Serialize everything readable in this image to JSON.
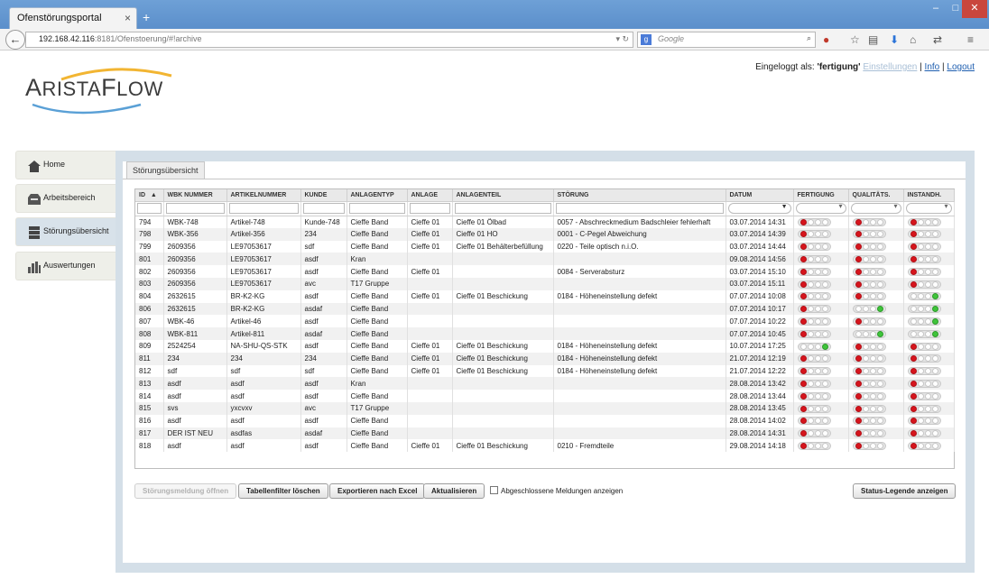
{
  "browser": {
    "tab_title": "Ofenstörungsportal",
    "url_host": "192.168.42.116",
    "url_rest": ":8181/Ofenstoerung/#!archive",
    "search_placeholder": "Google",
    "win_min": "–",
    "win_max": "□",
    "win_close": "✕"
  },
  "header": {
    "logo_first": "A",
    "logo_mid": "RISTA",
    "logo_f": "F",
    "logo_end": "LOW",
    "logged_in_label": "Eingeloggt als:",
    "user": "'fertigung'",
    "settings": "Einstellungen",
    "info": "Info",
    "logout": "Logout",
    "sep": "|"
  },
  "sidebar": {
    "items": [
      {
        "label": "Home",
        "icon": "home-icon"
      },
      {
        "label": "Arbeitsbereich",
        "icon": "inbox-icon"
      },
      {
        "label": "Störungsübersicht",
        "icon": "server-icon"
      },
      {
        "label": "Auswertungen",
        "icon": "bar-chart-icon"
      }
    ],
    "active_index": 2
  },
  "main": {
    "tab_label": "Störungsübersicht"
  },
  "table": {
    "sort_indicator": "▲",
    "columns": [
      "ID",
      "WBK NUMMER",
      "ARTIKELNUMMER",
      "KUNDE",
      "ANLAGENTYP",
      "ANLAGE",
      "ANLAGENTEIL",
      "STÖRUNG",
      "DATUM",
      "FERTIGUNG",
      "QUALITÄTS.",
      "INSTANDH."
    ],
    "rows": [
      {
        "id": "794",
        "wbk": "WBK-748",
        "artikel": "Artikel-748",
        "kunde": "Kunde-748",
        "typ": "Cieffe Band",
        "anlage": "Cieffe 01",
        "teil": "Cieffe 01 Ölbad",
        "stoerung": "0057 - Abschreckmedium Badschleier fehlerhaft",
        "datum": "03.07.2014 14:31",
        "f": "red",
        "q": "red",
        "i": "red"
      },
      {
        "id": "798",
        "wbk": "WBK-356",
        "artikel": "Artikel-356",
        "kunde": "234",
        "typ": "Cieffe Band",
        "anlage": "Cieffe 01",
        "teil": "Cieffe 01 HO",
        "stoerung": "0001 - C-Pegel Abweichung",
        "datum": "03.07.2014 14:39",
        "f": "red",
        "q": "red",
        "i": "red"
      },
      {
        "id": "799",
        "wbk": "2609356",
        "artikel": "LE97053617",
        "kunde": "sdf",
        "typ": "Cieffe Band",
        "anlage": "Cieffe 01",
        "teil": "Cieffe 01 Behälterbefüllung",
        "stoerung": "0220 - Teile optisch n.i.O.",
        "datum": "03.07.2014 14:44",
        "f": "red",
        "q": "red",
        "i": "red"
      },
      {
        "id": "801",
        "wbk": "2609356",
        "artikel": "LE97053617",
        "kunde": "asdf",
        "typ": "Kran",
        "anlage": "",
        "teil": "",
        "stoerung": "",
        "datum": "09.08.2014 14:56",
        "f": "red",
        "q": "red",
        "i": "red"
      },
      {
        "id": "802",
        "wbk": "2609356",
        "artikel": "LE97053617",
        "kunde": "asdf",
        "typ": "Cieffe Band",
        "anlage": "Cieffe 01",
        "teil": "",
        "stoerung": "0084 - Serverabsturz",
        "datum": "03.07.2014 15:10",
        "f": "red",
        "q": "red",
        "i": "red"
      },
      {
        "id": "803",
        "wbk": "2609356",
        "artikel": "LE97053617",
        "kunde": "avc",
        "typ": "T17 Gruppe",
        "anlage": "",
        "teil": "",
        "stoerung": "",
        "datum": "03.07.2014 15:11",
        "f": "red",
        "q": "red",
        "i": "red"
      },
      {
        "id": "804",
        "wbk": "2632615",
        "artikel": "BR-K2-KG",
        "kunde": "asdf",
        "typ": "Cieffe Band",
        "anlage": "Cieffe 01",
        "teil": "Cieffe 01 Beschickung",
        "stoerung": "0184 - Höheneinstellung defekt",
        "datum": "07.07.2014 10:08",
        "f": "red",
        "q": "red",
        "i": "green"
      },
      {
        "id": "806",
        "wbk": "2632615",
        "artikel": "BR-K2-KG",
        "kunde": "asdaf",
        "typ": "Cieffe Band",
        "anlage": "",
        "teil": "",
        "stoerung": "",
        "datum": "07.07.2014 10:17",
        "f": "red",
        "q": "green",
        "i": "green"
      },
      {
        "id": "807",
        "wbk": "WBK-46",
        "artikel": "Artikel-46",
        "kunde": "asdf",
        "typ": "Cieffe Band",
        "anlage": "",
        "teil": "",
        "stoerung": "",
        "datum": "07.07.2014 10:22",
        "f": "red",
        "q": "red",
        "i": "green"
      },
      {
        "id": "808",
        "wbk": "WBK-811",
        "artikel": "Artikel-811",
        "kunde": "asdaf",
        "typ": "Cieffe Band",
        "anlage": "",
        "teil": "",
        "stoerung": "",
        "datum": "07.07.2014 10:45",
        "f": "red",
        "q": "green",
        "i": "green"
      },
      {
        "id": "809",
        "wbk": "2524254",
        "artikel": "NA-SHU-QS-STK",
        "kunde": "asdf",
        "typ": "Cieffe Band",
        "anlage": "Cieffe 01",
        "teil": "Cieffe 01 Beschickung",
        "stoerung": "0184 - Höheneinstellung defekt",
        "datum": "10.07.2014 17:25",
        "f": "green",
        "q": "red",
        "i": "red"
      },
      {
        "id": "811",
        "wbk": "234",
        "artikel": "234",
        "kunde": "234",
        "typ": "Cieffe Band",
        "anlage": "Cieffe 01",
        "teil": "Cieffe 01 Beschickung",
        "stoerung": "0184 - Höheneinstellung defekt",
        "datum": "21.07.2014 12:19",
        "f": "red",
        "q": "red",
        "i": "red"
      },
      {
        "id": "812",
        "wbk": "sdf",
        "artikel": "sdf",
        "kunde": "sdf",
        "typ": "Cieffe Band",
        "anlage": "Cieffe 01",
        "teil": "Cieffe 01 Beschickung",
        "stoerung": "0184 - Höheneinstellung defekt",
        "datum": "21.07.2014 12:22",
        "f": "red",
        "q": "red",
        "i": "red"
      },
      {
        "id": "813",
        "wbk": "asdf",
        "artikel": "asdf",
        "kunde": "asdf",
        "typ": "Kran",
        "anlage": "",
        "teil": "",
        "stoerung": "",
        "datum": "28.08.2014 13:42",
        "f": "red",
        "q": "red",
        "i": "red"
      },
      {
        "id": "814",
        "wbk": "asdf",
        "artikel": "asdf",
        "kunde": "asdf",
        "typ": "Cieffe Band",
        "anlage": "",
        "teil": "",
        "stoerung": "",
        "datum": "28.08.2014 13:44",
        "f": "red",
        "q": "red",
        "i": "red"
      },
      {
        "id": "815",
        "wbk": "svs",
        "artikel": "yxcvxv",
        "kunde": "avc",
        "typ": "T17 Gruppe",
        "anlage": "",
        "teil": "",
        "stoerung": "",
        "datum": "28.08.2014 13:45",
        "f": "red",
        "q": "red",
        "i": "red"
      },
      {
        "id": "816",
        "wbk": "asdf",
        "artikel": "asdf",
        "kunde": "asdf",
        "typ": "Cieffe Band",
        "anlage": "",
        "teil": "",
        "stoerung": "",
        "datum": "28.08.2014 14:02",
        "f": "red",
        "q": "red",
        "i": "red"
      },
      {
        "id": "817",
        "wbk": "DER IST NEU",
        "artikel": "asdfas",
        "kunde": "asdaf",
        "typ": "Cieffe Band",
        "anlage": "",
        "teil": "",
        "stoerung": "",
        "datum": "28.08.2014 14:31",
        "f": "red",
        "q": "red",
        "i": "red"
      },
      {
        "id": "818",
        "wbk": "asdf",
        "artikel": "asdf",
        "kunde": "asdf",
        "typ": "Cieffe Band",
        "anlage": "Cieffe 01",
        "teil": "Cieffe 01 Beschickung",
        "stoerung": "0210 - Fremdteile",
        "datum": "29.08.2014 14:18",
        "f": "red",
        "q": "red",
        "i": "red"
      }
    ]
  },
  "actions": {
    "open_message": "Störungsmeldung öffnen",
    "clear_filter": "Tabellenfilter löschen",
    "export_excel": "Exportieren nach Excel",
    "refresh": "Aktualisieren",
    "show_closed": "Abgeschlossene Meldungen anzeigen",
    "show_legend": "Status-Legende anzeigen"
  },
  "colors": {
    "accent": "#1f5fb0",
    "status_red": "#d7141c",
    "status_green": "#3fc43a",
    "panel": "#d4dfe8"
  }
}
